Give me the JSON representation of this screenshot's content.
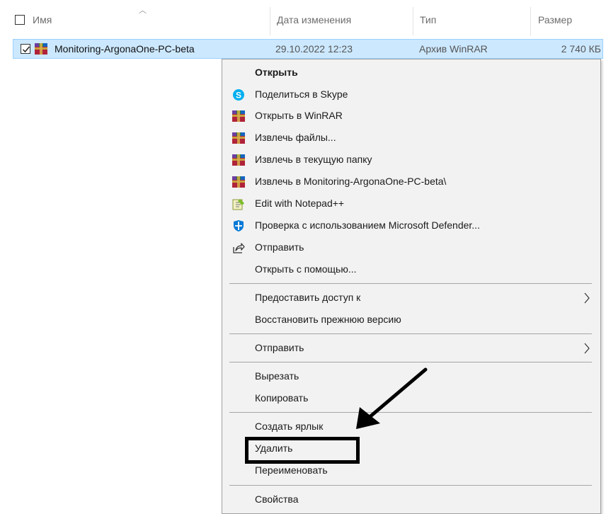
{
  "header": {
    "name_label": "Имя",
    "date_label": "Дата изменения",
    "type_label": "Тип",
    "size_label": "Размер"
  },
  "file": {
    "name": "Monitoring-ArgonaOne-PC-beta",
    "date": "29.10.2022 12:23",
    "type": "Архив WinRAR",
    "size": "2 740 КБ",
    "checked": true
  },
  "menu": {
    "items": [
      {
        "label": "Открыть",
        "icon": "none",
        "bold": true
      },
      {
        "label": "Поделиться в Skype",
        "icon": "skype-icon"
      },
      {
        "label": "Открыть в WinRAR",
        "icon": "winrar-icon"
      },
      {
        "label": "Извлечь файлы...",
        "icon": "winrar-icon"
      },
      {
        "label": "Извлечь в текущую папку",
        "icon": "winrar-icon"
      },
      {
        "label": "Извлечь в Monitoring-ArgonaOne-PC-beta\\",
        "icon": "winrar-icon"
      },
      {
        "label": "Edit with Notepad++",
        "icon": "notepad-plus-plus-icon"
      },
      {
        "label": "Проверка с использованием Microsoft Defender...",
        "icon": "defender-shield-icon"
      },
      {
        "label": "Отправить",
        "icon": "share-icon"
      },
      {
        "label": "Открыть с помощью...",
        "icon": "none"
      },
      {
        "label": "Предоставить доступ к",
        "icon": "none",
        "submenu": true
      },
      {
        "label": "Восстановить прежнюю версию",
        "icon": "none"
      },
      {
        "label": "Отправить",
        "icon": "none",
        "submenu": true
      },
      {
        "label": "Вырезать",
        "icon": "none"
      },
      {
        "label": "Копировать",
        "icon": "none"
      },
      {
        "label": "Создать ярлык",
        "icon": "none"
      },
      {
        "label": "Удалить",
        "icon": "none",
        "highlighted": true
      },
      {
        "label": "Переименовать",
        "icon": "none"
      },
      {
        "label": "Свойства",
        "icon": "none"
      }
    ]
  },
  "colors": {
    "selection_bg": "#cce8ff",
    "selection_border": "#99d1ff",
    "menu_bg": "#f2f2f2",
    "skype_blue": "#00aff0",
    "defender_blue": "#0078d7",
    "annotation": "#000000"
  }
}
